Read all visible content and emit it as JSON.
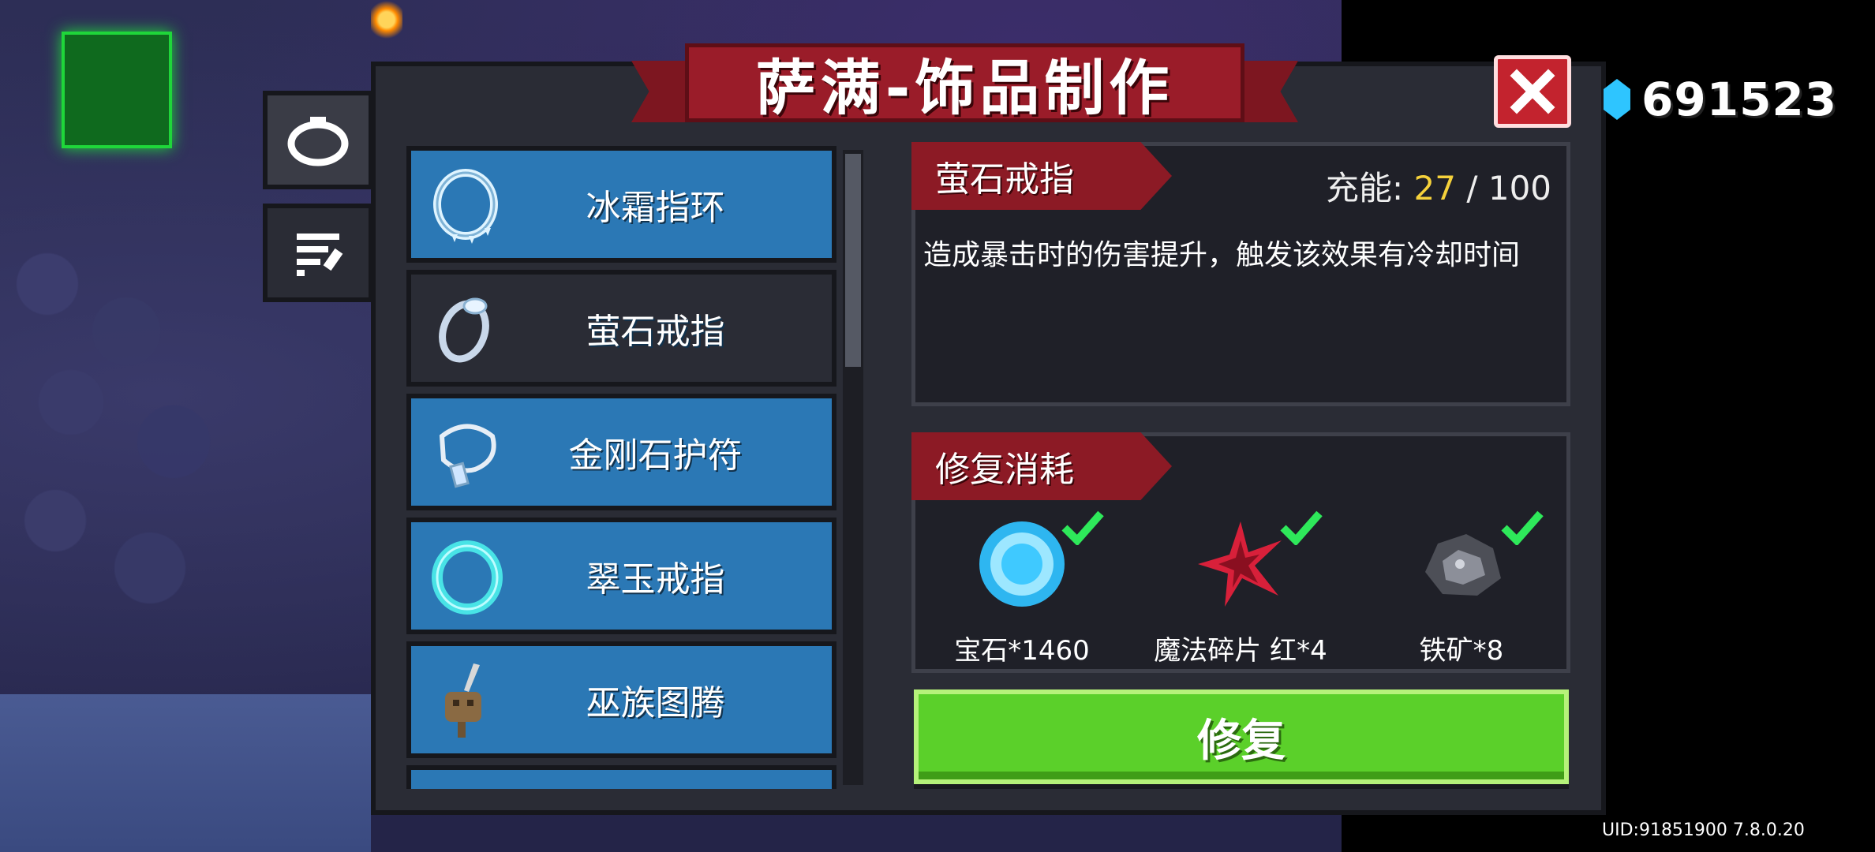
{
  "title": "萨满-饰品制作",
  "currency": {
    "icon": "blue-gem-icon",
    "value": "691523"
  },
  "tabs": [
    {
      "icon": "ring-icon",
      "active": true
    },
    {
      "icon": "scroll-list-icon",
      "active": false
    }
  ],
  "items": [
    {
      "label": "冰霜指环",
      "icon": "frost-ring-icon"
    },
    {
      "label": "萤石戒指",
      "icon": "fluorite-ring-icon",
      "selected": true
    },
    {
      "label": "金刚石护符",
      "icon": "diamond-amulet-icon"
    },
    {
      "label": "翠玉戒指",
      "icon": "jade-ring-icon"
    },
    {
      "label": "巫族图腾",
      "icon": "witch-totem-icon"
    }
  ],
  "detail": {
    "name": "萤石戒指",
    "energy_label": "充能:",
    "energy_current": "27",
    "energy_sep": "/",
    "energy_max": "100",
    "description": "造成暴击时的伤害提升，触发该效果有冷却时间"
  },
  "cost": {
    "title": "修复消耗",
    "materials": [
      {
        "label": "宝石*1460",
        "icon": "gem-icon",
        "met": true
      },
      {
        "label": "魔法碎片 红*4",
        "icon": "red-magic-shard-icon",
        "met": true
      },
      {
        "label": "铁矿*8",
        "icon": "iron-ore-icon",
        "met": true
      }
    ]
  },
  "repair_button": "修复",
  "uid": "UID:91851900 7.8.0.20",
  "colors": {
    "item_blue": "#2b78b5",
    "ribbon_red": "#8c1a25",
    "button_green": "#5bd02a",
    "energy_yellow": "#f5d13b"
  }
}
